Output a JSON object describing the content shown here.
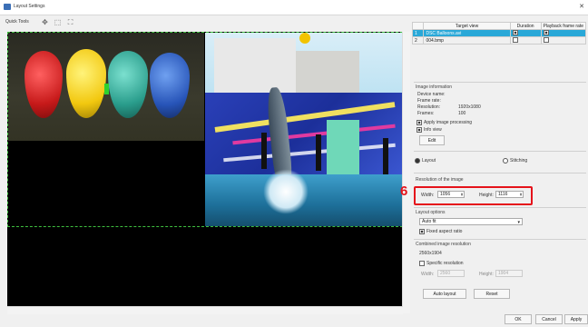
{
  "window": {
    "title": "Layout Settings",
    "close_glyph": "✕"
  },
  "toolbar": {
    "label": "Quick Tools",
    "icons": [
      "move-icon",
      "pointer-icon",
      "fit-icon"
    ]
  },
  "target_view": {
    "headers": [
      "",
      "Target view",
      "Duration",
      "Playback frame rate"
    ],
    "rows": [
      {
        "num": "1",
        "name": "DSC Balloons.avi",
        "duration_checked": true,
        "framerate_checked": true
      },
      {
        "num": "2",
        "name": "004.bmp",
        "duration_checked": false,
        "framerate_checked": false
      }
    ]
  },
  "image_info": {
    "heading": "Image information",
    "device_name_label": "Device name:",
    "frame_rate_label": "Frame rate:",
    "resolution_label": "Resolution:",
    "resolution_value": "1920x1080",
    "frames_label": "Frames:",
    "frames_value": "100",
    "apply_processing": "Apply image processing",
    "info_view": "Info view",
    "edit": "Edit"
  },
  "mode": {
    "layout": "Layout",
    "stitching": "Stitching"
  },
  "resolution": {
    "heading": "Resolution of the image",
    "width_label": "Width:",
    "width_value": "1056",
    "height_label": "Height:",
    "height_value": "1116",
    "callout": "6"
  },
  "layout_options": {
    "heading": "Layout options",
    "select_value": "Auto fit",
    "fixed_aspect": "Fixed aspect ratio"
  },
  "combined": {
    "heading": "Combined image resolution",
    "value": "2560x1904",
    "specific": "Specific resolution",
    "width_label": "Width:",
    "width_value": "2560",
    "height_label": "Height:",
    "height_value": "1904"
  },
  "buttons": {
    "auto_layout": "Auto layout",
    "reset": "Reset",
    "ok": "OK",
    "cancel": "Cancel",
    "apply": "Apply"
  },
  "colors": {
    "highlight": "#29a8d8",
    "callout": "#e5131b",
    "pane_border": "#3fbf3f"
  }
}
